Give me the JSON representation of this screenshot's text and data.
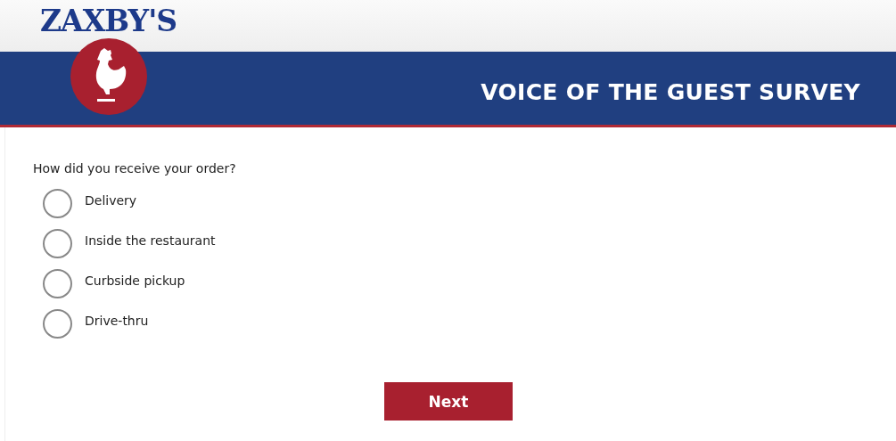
{
  "header": {
    "logo": "ZAXBY'S",
    "title": "VOICE OF THE GUEST SURVEY"
  },
  "question": {
    "text": "How did you receive your order?",
    "options": [
      {
        "label": "Delivery",
        "selected": false
      },
      {
        "label": "Inside the restaurant",
        "selected": false
      },
      {
        "label": "Curbside pickup",
        "selected": false
      },
      {
        "label": "Drive-thru",
        "selected": false
      }
    ]
  },
  "buttons": [
    {
      "label": "Next"
    }
  ]
}
